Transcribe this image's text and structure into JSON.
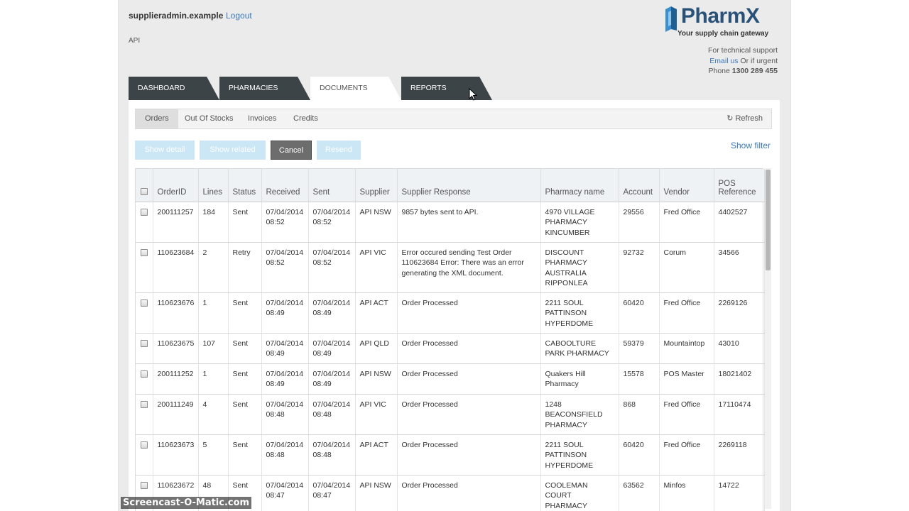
{
  "header": {
    "username": "supplieradmin.example",
    "logout_label": "Logout",
    "section_label": "API"
  },
  "logo": {
    "brand": "PharmX",
    "tagline": "Your supply chain gateway",
    "brand_color": "#2a5278"
  },
  "support": {
    "line1": "For technical support",
    "email_link": "Email us",
    "line2_suffix": " Or if urgent",
    "phone_prefix": "Phone ",
    "phone_number": "1300 289 455"
  },
  "tabs": [
    {
      "label": "DASHBOARD"
    },
    {
      "label": "PHARMACIES"
    },
    {
      "label": "DOCUMENTS",
      "active": true
    },
    {
      "label": "REPORTS"
    }
  ],
  "subnav": {
    "items": [
      "Orders",
      "Out Of Stocks",
      "Invoices",
      "Credits"
    ],
    "active": "Orders",
    "refresh_label": "Refresh"
  },
  "actions": {
    "show_detail": "Show detail",
    "show_related": "Show related",
    "cancel": "Cancel",
    "resend": "Resend",
    "show_filter": "Show filter"
  },
  "table": {
    "columns": [
      "OrderID",
      "Lines",
      "Status",
      "Received",
      "Sent",
      "Supplier",
      "Supplier Response",
      "Pharmacy name",
      "Account",
      "Vendor",
      "POS Reference"
    ],
    "rows": [
      {
        "order_id": "200111257",
        "lines": "184",
        "status": "Sent",
        "received": "07/04/2014 08:52",
        "sent": "07/04/2014 08:52",
        "supplier": "API NSW",
        "response": "9857 bytes sent to API.",
        "pharmacy": "4970 VILLAGE PHARMACY KINCUMBER",
        "account": "29556",
        "vendor": "Fred Office",
        "pos_ref": "4402527"
      },
      {
        "order_id": "110623684",
        "lines": "2",
        "status": "Retry",
        "received": "07/04/2014 08:52",
        "sent": "07/04/2014 08:52",
        "supplier": "API VIC",
        "response": "Error occured sending Test Order 110623684 Error: There was an error generating the XML document.",
        "pharmacy": "DISCOUNT PHARMACY AUSTRALIA RIPPONLEA",
        "account": "92732",
        "vendor": "Corum",
        "pos_ref": "34566"
      },
      {
        "order_id": "110623676",
        "lines": "1",
        "status": "Sent",
        "received": "07/04/2014 08:49",
        "sent": "07/04/2014 08:49",
        "supplier": "API ACT",
        "response": "Order Processed",
        "pharmacy": "2211 SOUL PATTINSON HYPERDOME",
        "account": "60420",
        "vendor": "Fred Office",
        "pos_ref": "2269126"
      },
      {
        "order_id": "110623675",
        "lines": "107",
        "status": "Sent",
        "received": "07/04/2014 08:49",
        "sent": "07/04/2014 08:49",
        "supplier": "API QLD",
        "response": "Order Processed",
        "pharmacy": "CABOOLTURE PARK PHARMACY",
        "account": "59379",
        "vendor": "Mountaintop",
        "pos_ref": "43010"
      },
      {
        "order_id": "200111252",
        "lines": "1",
        "status": "Sent",
        "received": "07/04/2014 08:49",
        "sent": "07/04/2014 08:49",
        "supplier": "API NSW",
        "response": "Order Processed",
        "pharmacy": "Quakers Hill Pharmacy",
        "account": "15578",
        "vendor": "POS Master",
        "pos_ref": "18021402"
      },
      {
        "order_id": "200111249",
        "lines": "4",
        "status": "Sent",
        "received": "07/04/2014 08:48",
        "sent": "07/04/2014 08:48",
        "supplier": "API VIC",
        "response": "Order Processed",
        "pharmacy": "1248 BEACONSFIELD PHARMACY",
        "account": "868",
        "vendor": "Fred Office",
        "pos_ref": "17110474"
      },
      {
        "order_id": "110623673",
        "lines": "5",
        "status": "Sent",
        "received": "07/04/2014 08:48",
        "sent": "07/04/2014 08:48",
        "supplier": "API ACT",
        "response": "Order Processed",
        "pharmacy": "2211 SOUL PATTINSON HYPERDOME",
        "account": "60420",
        "vendor": "Fred Office",
        "pos_ref": "2269118"
      },
      {
        "order_id": "110623672",
        "lines": "48",
        "status": "Sent",
        "received": "07/04/2014 08:47",
        "sent": "07/04/2014 08:47",
        "supplier": "API NSW",
        "response": "Order Processed",
        "pharmacy": "COOLEMAN COURT PHARMACY",
        "account": "63562",
        "vendor": "Minfos",
        "pos_ref": "14722"
      }
    ]
  },
  "watermark": "Screencast-O-Matic.com",
  "colors": {
    "tab_dark": "#3d4448",
    "link": "#3b78b8",
    "page_bg": "#ebebeb",
    "header_row_bg": "#eef2f5",
    "disabled_button": "#cbe6f4"
  }
}
